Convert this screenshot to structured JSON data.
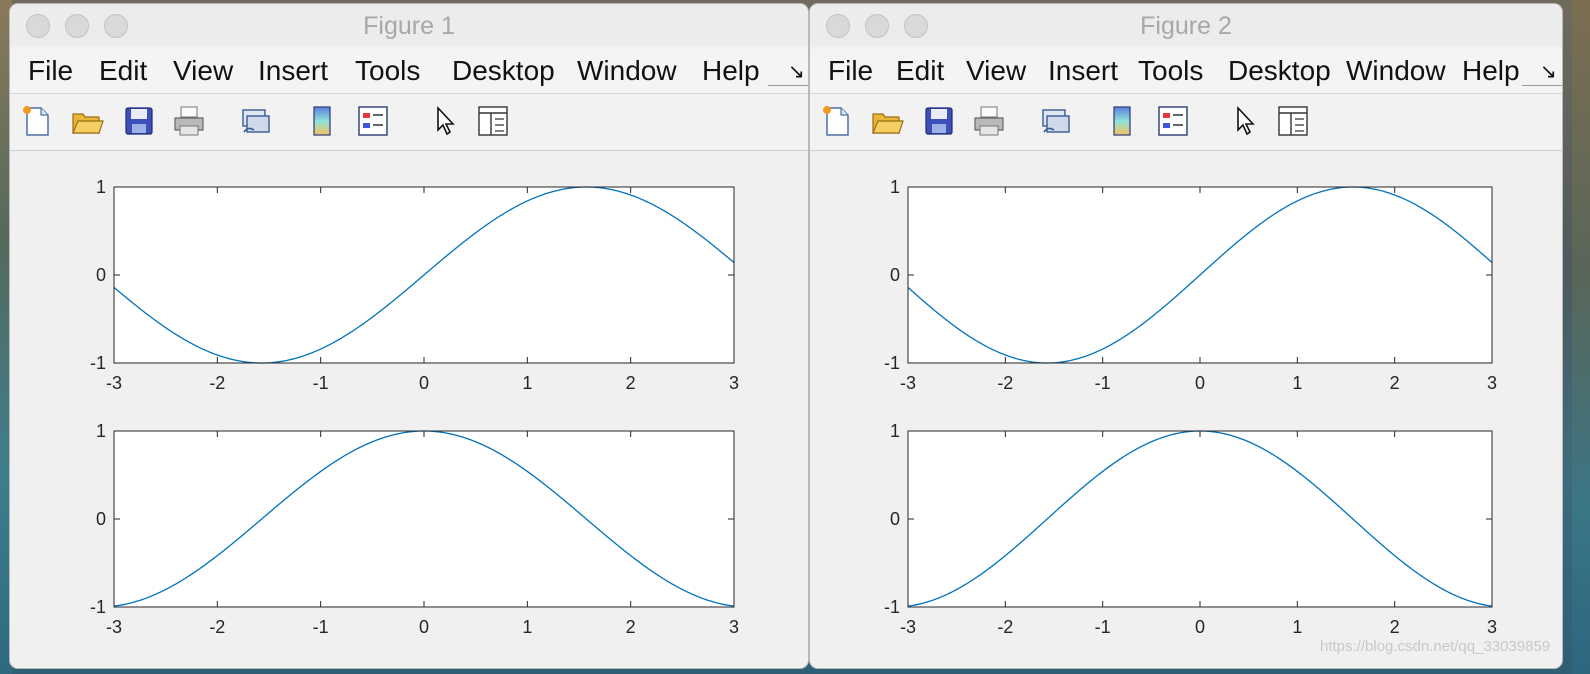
{
  "windows": [
    {
      "title": "Figure 1",
      "menu": [
        "File",
        "Edit",
        "View",
        "Insert",
        "Tools",
        "Desktop",
        "Window",
        "Help"
      ],
      "more_glyph": "↘"
    },
    {
      "title": "Figure 2",
      "menu": [
        "File",
        "Edit",
        "View",
        "Insert",
        "Tools",
        "Desktop",
        "Window",
        "Help"
      ],
      "more_glyph": "↘"
    }
  ],
  "toolbar_icons": [
    "new-figure-icon",
    "open-file-icon",
    "save-icon",
    "print-icon",
    "link-icon",
    "colorbar-icon",
    "legend-icon",
    "pointer-icon",
    "property-inspector-icon"
  ],
  "watermark": "https://blog.csdn.net/qq_33039859",
  "colors": {
    "line": "#0072bd",
    "axes_bg": "#ffffff",
    "figure_bg": "#f0f0f0"
  },
  "chart_data": [
    {
      "type": "line",
      "figure": "Figure 1",
      "subplot": 1,
      "function": "sin(x)",
      "xlim": [
        -3,
        3
      ],
      "ylim": [
        -1,
        1
      ],
      "xticks": [
        "-3",
        "-2",
        "-1",
        "0",
        "1",
        "2",
        "3"
      ],
      "yticks": [
        "-1",
        "0",
        "1"
      ],
      "series": [
        {
          "x": [
            -3,
            -2.5,
            -2,
            -1.5708,
            -1,
            -0.5,
            0,
            0.5,
            1,
            1.5708,
            2,
            2.5,
            3
          ],
          "y": [
            -0.141,
            -0.598,
            -0.909,
            -1,
            -0.841,
            -0.479,
            0,
            0.479,
            0.841,
            1,
            0.909,
            0.598,
            0.141
          ]
        }
      ]
    },
    {
      "type": "line",
      "figure": "Figure 1",
      "subplot": 2,
      "function": "cos(x)",
      "xlim": [
        -3,
        3
      ],
      "ylim": [
        -1,
        1
      ],
      "xticks": [
        "-3",
        "-2",
        "-1",
        "0",
        "1",
        "2",
        "3"
      ],
      "yticks": [
        "-1",
        "0",
        "1"
      ],
      "series": [
        {
          "x": [
            -3,
            -2.5,
            -2,
            -1.5,
            -1,
            -0.5,
            0,
            0.5,
            1,
            1.5,
            2,
            2.5,
            3
          ],
          "y": [
            -0.99,
            -0.801,
            -0.416,
            0.071,
            0.54,
            0.878,
            1,
            0.878,
            0.54,
            0.071,
            -0.416,
            -0.801,
            -0.99
          ]
        }
      ]
    },
    {
      "type": "line",
      "figure": "Figure 2",
      "subplot": 1,
      "function": "sin(x)",
      "xlim": [
        -3,
        3
      ],
      "ylim": [
        -1,
        1
      ],
      "xticks": [
        "-3",
        "-2",
        "-1",
        "0",
        "1",
        "2",
        "3"
      ],
      "yticks": [
        "-1",
        "0",
        "1"
      ],
      "series": [
        {
          "x": [
            -3,
            -2.5,
            -2,
            -1.5708,
            -1,
            -0.5,
            0,
            0.5,
            1,
            1.5708,
            2,
            2.5,
            3
          ],
          "y": [
            -0.141,
            -0.598,
            -0.909,
            -1,
            -0.841,
            -0.479,
            0,
            0.479,
            0.841,
            1,
            0.909,
            0.598,
            0.141
          ]
        }
      ]
    },
    {
      "type": "line",
      "figure": "Figure 2",
      "subplot": 2,
      "function": "cos(x)",
      "xlim": [
        -3,
        3
      ],
      "ylim": [
        -1,
        1
      ],
      "xticks": [
        "-3",
        "-2",
        "-1",
        "0",
        "1",
        "2",
        "3"
      ],
      "yticks": [
        "-1",
        "0",
        "1"
      ],
      "series": [
        {
          "x": [
            -3,
            -2.5,
            -2,
            -1.5,
            -1,
            -0.5,
            0,
            0.5,
            1,
            1.5,
            2,
            2.5,
            3
          ],
          "y": [
            -0.99,
            -0.801,
            -0.416,
            0.071,
            0.54,
            0.878,
            1,
            0.878,
            0.54,
            0.071,
            -0.416,
            -0.801,
            -0.99
          ]
        }
      ]
    }
  ]
}
